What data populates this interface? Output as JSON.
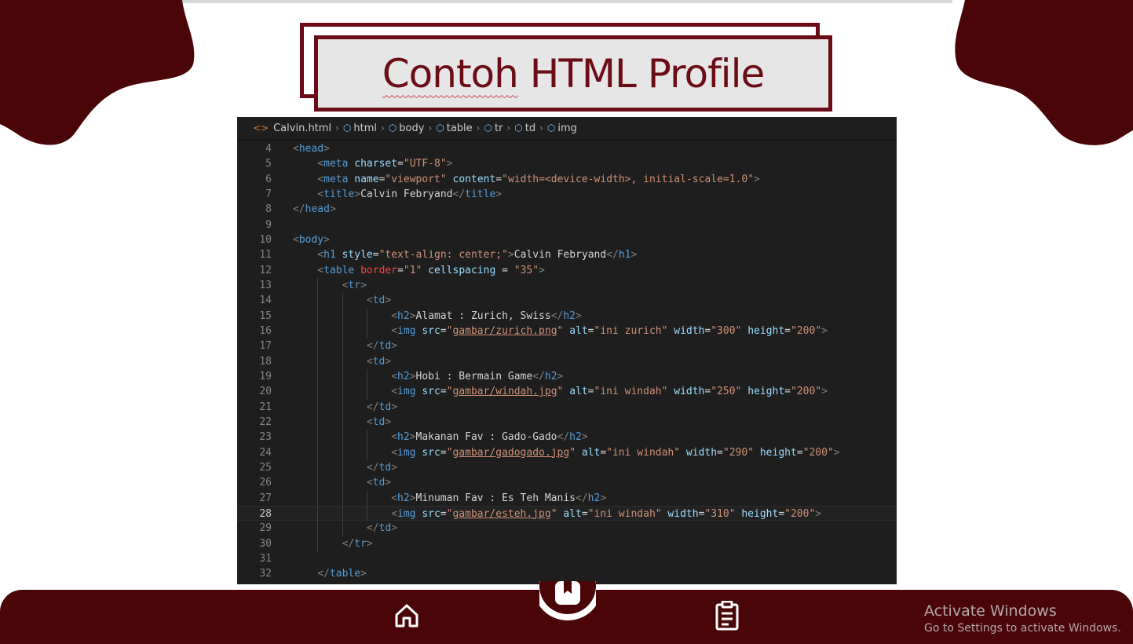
{
  "slide": {
    "title": "Contoh HTML Profile",
    "title_parts": [
      "Contoh",
      " HTML Profile"
    ],
    "colors": {
      "accent": "#6b0c16",
      "bar": "#4a0509"
    }
  },
  "editor": {
    "breadcrumb": [
      "Calvin.html",
      "html",
      "body",
      "table",
      "tr",
      "td",
      "img"
    ],
    "current_line": 28,
    "lines": [
      {
        "n": "4",
        "indent": 0,
        "html": "<span class='t-bracket'>&lt;</span><span class='t-tag'>head</span><span class='t-bracket'>&gt;</span>"
      },
      {
        "n": "5",
        "indent": 1,
        "html": "<span class='t-bracket'>&lt;</span><span class='t-tag'>meta</span> <span class='t-attr'>charset</span>=<span class='t-val'>\"UTF-8\"</span><span class='t-bracket'>&gt;</span>"
      },
      {
        "n": "6",
        "indent": 1,
        "html": "<span class='t-bracket'>&lt;</span><span class='t-tag'>meta</span> <span class='t-attr'>name</span>=<span class='t-val'>\"viewport\"</span> <span class='t-attr'>content</span>=<span class='t-val'>\"width=&lt;device-width&gt;, initial-scale=1.0\"</span><span class='t-bracket'>&gt;</span>"
      },
      {
        "n": "7",
        "indent": 1,
        "html": "<span class='t-bracket'>&lt;</span><span class='t-tag'>title</span><span class='t-bracket'>&gt;</span>Calvin Febryand<span class='t-bracket'>&lt;/</span><span class='t-tag'>title</span><span class='t-bracket'>&gt;</span>"
      },
      {
        "n": "8",
        "indent": 0,
        "html": "<span class='t-bracket'>&lt;/</span><span class='t-tag'>head</span><span class='t-bracket'>&gt;</span>"
      },
      {
        "n": "9",
        "indent": 0,
        "html": ""
      },
      {
        "n": "10",
        "indent": 0,
        "html": "<span class='t-bracket'>&lt;</span><span class='t-tag'>body</span><span class='t-bracket'>&gt;</span>"
      },
      {
        "n": "11",
        "indent": 1,
        "html": "<span class='t-bracket'>&lt;</span><span class='t-tag'>h1</span> <span class='t-attr'>style</span>=<span class='t-val'>\"text-align: center;\"</span><span class='t-bracket'>&gt;</span>Calvin Febryand<span class='t-bracket'>&lt;/</span><span class='t-tag'>h1</span><span class='t-bracket'>&gt;</span>"
      },
      {
        "n": "12",
        "indent": 1,
        "html": "<span class='t-bracket'>&lt;</span><span class='t-tag'>table</span> <span class='t-bad'>border</span>=<span class='t-val'>\"1\"</span> <span class='t-attr'>cellspacing</span> = <span class='t-val'>\"35\"</span><span class='t-bracket'>&gt;</span>"
      },
      {
        "n": "13",
        "indent": 2,
        "html": "<span class='t-bracket'>&lt;</span><span class='t-tag'>tr</span><span class='t-bracket'>&gt;</span>"
      },
      {
        "n": "14",
        "indent": 3,
        "html": "<span class='t-bracket'>&lt;</span><span class='t-tag'>td</span><span class='t-bracket'>&gt;</span>"
      },
      {
        "n": "15",
        "indent": 4,
        "html": "<span class='t-bracket'>&lt;</span><span class='t-tag'>h2</span><span class='t-bracket'>&gt;</span>Alamat : Zurich, Swiss<span class='t-bracket'>&lt;/</span><span class='t-tag'>h2</span><span class='t-bracket'>&gt;</span>"
      },
      {
        "n": "16",
        "indent": 4,
        "html": "<span class='t-bracket'>&lt;</span><span class='t-tag'>img</span> <span class='t-attr'>src</span>=<span class='t-val'>\"</span><span class='t-link'>gambar/zurich.png</span><span class='t-val'>\"</span> <span class='t-attr'>alt</span>=<span class='t-val'>\"ini zurich\"</span> <span class='t-attr'>width</span>=<span class='t-val'>\"300\"</span> <span class='t-attr'>height</span>=<span class='t-val'>\"200\"</span><span class='t-bracket'>&gt;</span>"
      },
      {
        "n": "17",
        "indent": 3,
        "html": "<span class='t-bracket'>&lt;/</span><span class='t-tag'>td</span><span class='t-bracket'>&gt;</span>"
      },
      {
        "n": "18",
        "indent": 3,
        "html": "<span class='t-bracket'>&lt;</span><span class='t-tag'>td</span><span class='t-bracket'>&gt;</span>"
      },
      {
        "n": "19",
        "indent": 4,
        "html": "<span class='t-bracket'>&lt;</span><span class='t-tag'>h2</span><span class='t-bracket'>&gt;</span>Hobi : Bermain Game<span class='t-bracket'>&lt;/</span><span class='t-tag'>h2</span><span class='t-bracket'>&gt;</span>"
      },
      {
        "n": "20",
        "indent": 4,
        "html": "<span class='t-bracket'>&lt;</span><span class='t-tag'>img</span> <span class='t-attr'>src</span>=<span class='t-val'>\"</span><span class='t-link'>gambar/windah.jpg</span><span class='t-val'>\"</span> <span class='t-attr'>alt</span>=<span class='t-val'>\"ini windah\"</span> <span class='t-attr'>width</span>=<span class='t-val'>\"250\"</span> <span class='t-attr'>height</span>=<span class='t-val'>\"200\"</span><span class='t-bracket'>&gt;</span>"
      },
      {
        "n": "21",
        "indent": 3,
        "html": "<span class='t-bracket'>&lt;/</span><span class='t-tag'>td</span><span class='t-bracket'>&gt;</span>"
      },
      {
        "n": "22",
        "indent": 3,
        "html": "<span class='t-bracket'>&lt;</span><span class='t-tag'>td</span><span class='t-bracket'>&gt;</span>"
      },
      {
        "n": "23",
        "indent": 4,
        "html": "<span class='t-bracket'>&lt;</span><span class='t-tag'>h2</span><span class='t-bracket'>&gt;</span>Makanan Fav : Gado-Gado<span class='t-bracket'>&lt;/</span><span class='t-tag'>h2</span><span class='t-bracket'>&gt;</span>"
      },
      {
        "n": "24",
        "indent": 4,
        "html": "<span class='t-bracket'>&lt;</span><span class='t-tag'>img</span> <span class='t-attr'>src</span>=<span class='t-val'>\"</span><span class='t-link'>gambar/gadogado.jpg</span><span class='t-val'>\"</span> <span class='t-attr'>alt</span>=<span class='t-val'>\"ini windah\"</span> <span class='t-attr'>width</span>=<span class='t-val'>\"290\"</span> <span class='t-attr'>height</span>=<span class='t-val'>\"200\"</span><span class='t-bracket'>&gt;</span>"
      },
      {
        "n": "25",
        "indent": 3,
        "html": "<span class='t-bracket'>&lt;/</span><span class='t-tag'>td</span><span class='t-bracket'>&gt;</span>"
      },
      {
        "n": "26",
        "indent": 3,
        "html": "<span class='t-bracket'>&lt;</span><span class='t-tag'>td</span><span class='t-bracket'>&gt;</span>"
      },
      {
        "n": "27",
        "indent": 4,
        "html": "<span class='t-bracket'>&lt;</span><span class='t-tag'>h2</span><span class='t-bracket'>&gt;</span>Minuman Fav : Es Teh Manis<span class='t-bracket'>&lt;/</span><span class='t-tag'>h2</span><span class='t-bracket'>&gt;</span>"
      },
      {
        "n": "28",
        "indent": 4,
        "html": "<span class='t-bracket'>&lt;</span><span class='t-tag'>img</span> <span class='t-attr'>src</span>=<span class='t-val'>\"</span><span class='t-link'>gambar/esteh.jpg</span><span class='t-val'>\"</span> <span class='t-attr'>alt</span>=<span class='t-val'>\"ini windah\"</span> <span class='t-attr'>width</span>=<span class='t-val'>\"310\"</span> <span class='t-attr'>height</span>=<span class='t-val'>\"200\"</span><span class='t-bracket'>&gt;</span>"
      },
      {
        "n": "29",
        "indent": 3,
        "html": "<span class='t-bracket'>&lt;/</span><span class='t-tag'>td</span><span class='t-bracket'>&gt;</span>"
      },
      {
        "n": "30",
        "indent": 2,
        "html": "<span class='t-bracket'>&lt;/</span><span class='t-tag'>tr</span><span class='t-bracket'>&gt;</span>"
      },
      {
        "n": "31",
        "indent": 0,
        "html": ""
      },
      {
        "n": "32",
        "indent": 1,
        "html": "<span class='t-bracket'>&lt;/</span><span class='t-tag'>table</span><span class='t-bracket'>&gt;</span>"
      }
    ]
  },
  "bottom_nav": {
    "home_icon": "home-icon",
    "center_icon": "bookmark-icon",
    "clipboard_icon": "clipboard-icon"
  },
  "watermark": {
    "line1": "Activate Windows",
    "line2": "Go to Settings to activate Windows."
  }
}
